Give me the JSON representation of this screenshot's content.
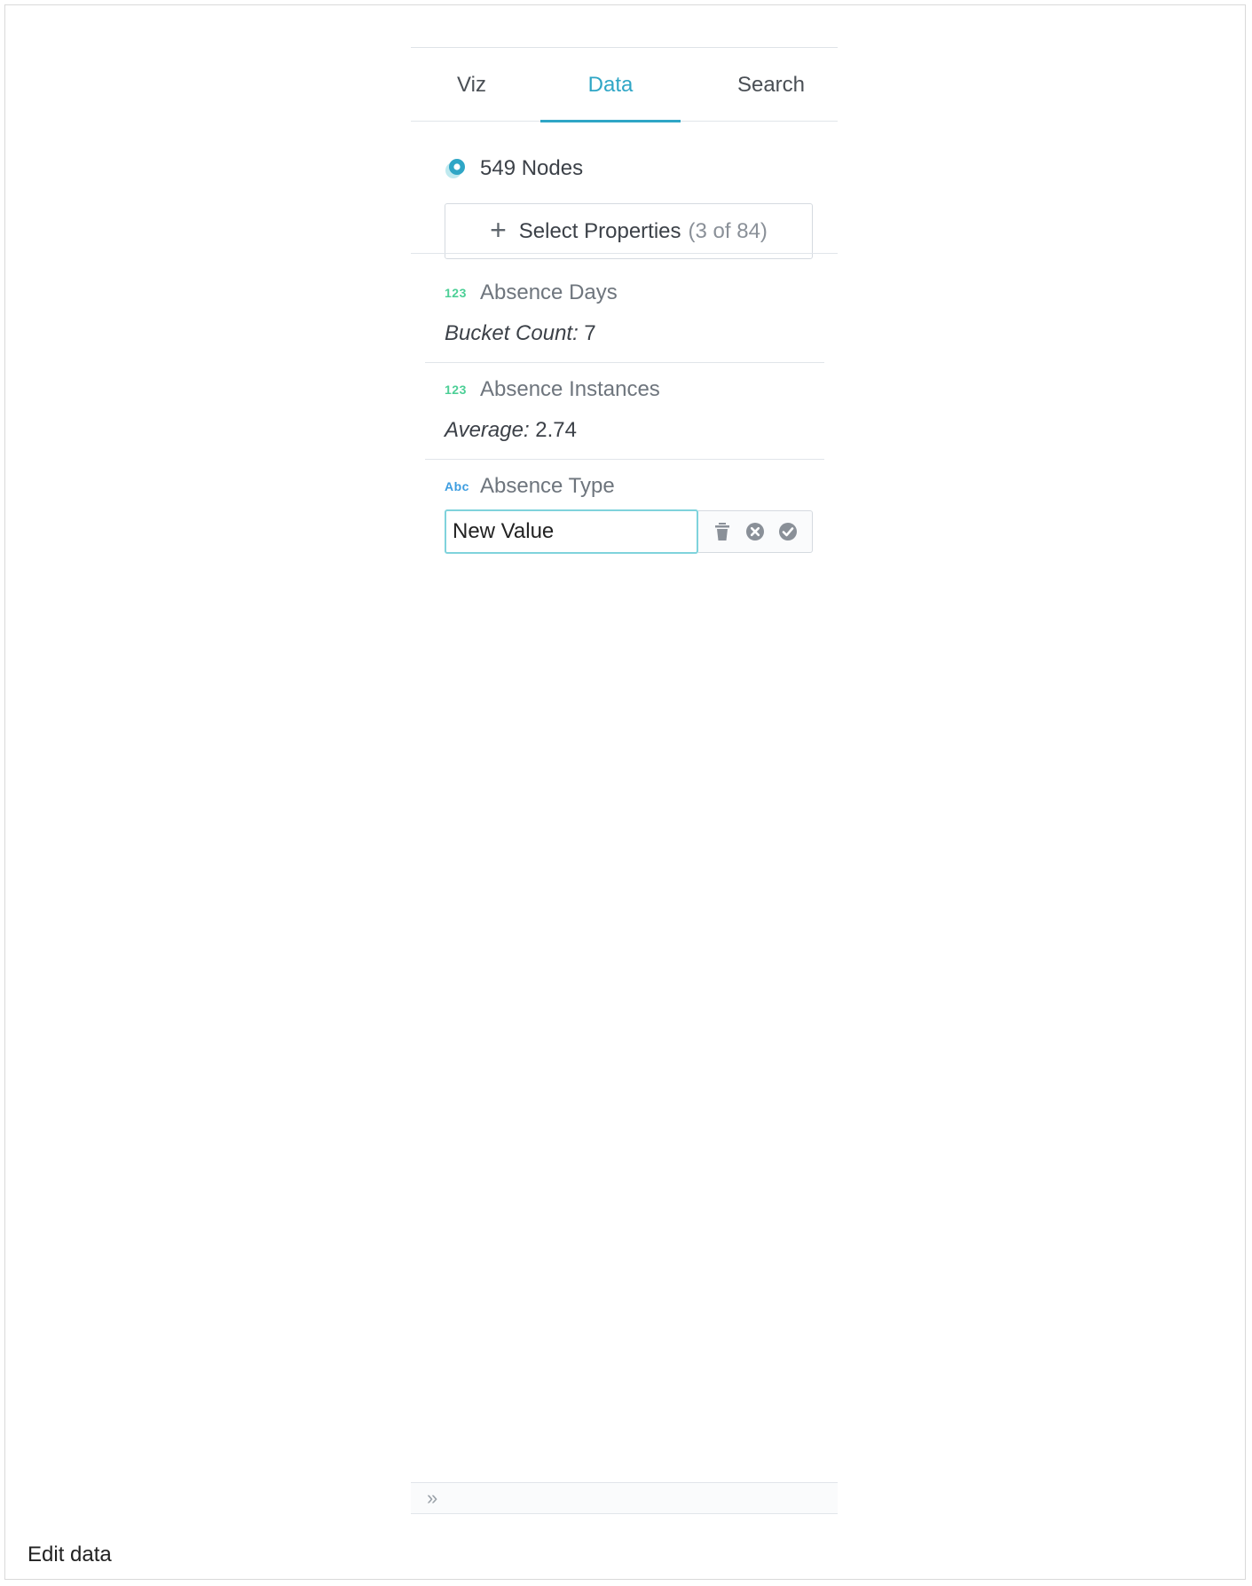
{
  "tabs": [
    {
      "label": "Viz"
    },
    {
      "label": "Data",
      "active": true
    },
    {
      "label": "Search"
    }
  ],
  "nodes": {
    "count_label": "549 Nodes",
    "icon": "node-icon"
  },
  "select_properties": {
    "label": "Select Properties",
    "count": "(3 of 84)",
    "icon": "plus-icon"
  },
  "properties": [
    {
      "type_badge": "123",
      "name": "Absence Days",
      "stat_label": "Bucket Count:",
      "stat_value": " 7"
    },
    {
      "type_badge": "123",
      "name": "Absence Instances",
      "stat_label": "Average:",
      "stat_value": " 2.74"
    },
    {
      "type_badge": "Abc",
      "name": "Absence Type"
    }
  ],
  "edit": {
    "value": "New Value",
    "actions": [
      "trash-icon",
      "cancel-icon",
      "confirm-icon"
    ]
  },
  "footer": {
    "collapse_glyph": "»"
  },
  "caption": "Edit data",
  "colors": {
    "accent": "#2fa6c6",
    "numeric_badge": "#4ccf96",
    "string_badge": "#3d9de0",
    "input_focus": "#7fd3dc"
  }
}
